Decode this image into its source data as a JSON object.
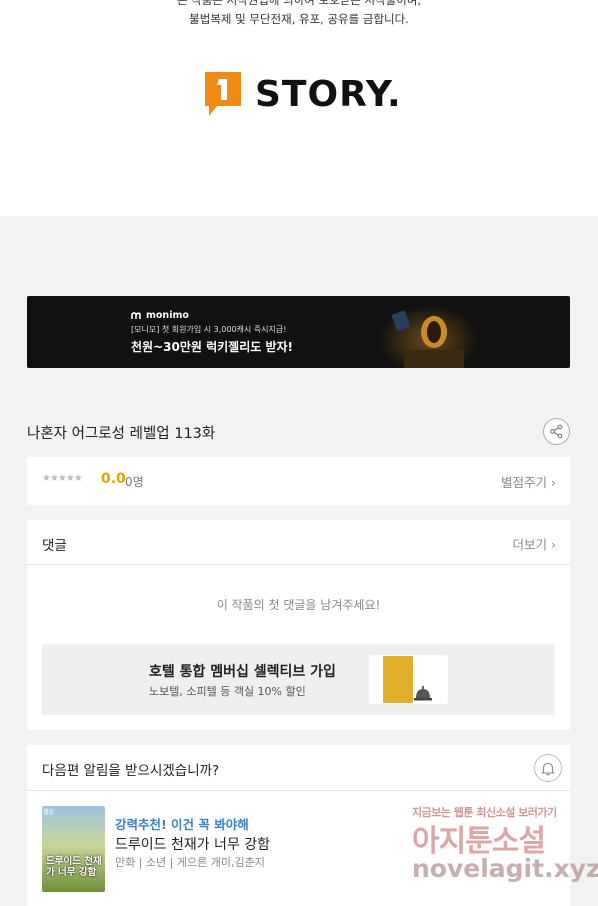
{
  "top": {
    "copyright_line1": "본 작품은 저작권법에 의하여 보호받는 저작물이며,",
    "copyright_line2": "불법복제 및 무단전재, 유포, 공유를 금합니다.",
    "logo_text": "STORY."
  },
  "banner": {
    "brand": "monimo",
    "sub": "[모니모] 첫 회원가입 시 3,000캐시 즉시지급!",
    "main": "천원~30만원 럭키젤리도 받자!"
  },
  "episode": {
    "title": "나혼자 어그로성 레벨업 113화"
  },
  "rating": {
    "stars": "★★★★★",
    "score": "0.0",
    "count": "0명",
    "rate_link": "별점주기 ›"
  },
  "comments": {
    "title": "댓글",
    "more": "더보기 ›",
    "empty": "이 작품의 첫 댓글을 남겨주세요!",
    "ad": {
      "title": "호텔 통합 멤버십 셀렉티브 가입",
      "sub": "노보텔, 소피텔 등 객실 10% 할인"
    }
  },
  "notify": {
    "title": "다음편 알림을 받으시겠습니까?",
    "rec": {
      "badge": "웹툰",
      "thumb_title": "드루이드 천재가 너무 강함",
      "tag": "강력추천! 이건 꼭 봐야해",
      "title": "드루이드 천재가 너무 강함",
      "meta": "만화 | 소년 | 게으른 개미,김춘지"
    }
  },
  "watermark": {
    "line1": "지금보는 웹툰 최신소설 보러가기",
    "line2": "아지툰소설",
    "line3": "novelagit.xyz"
  },
  "colors": {
    "accent_orange": "#f08a14",
    "score_yellow": "#e8a200",
    "tag_blue": "#3b82c4"
  }
}
